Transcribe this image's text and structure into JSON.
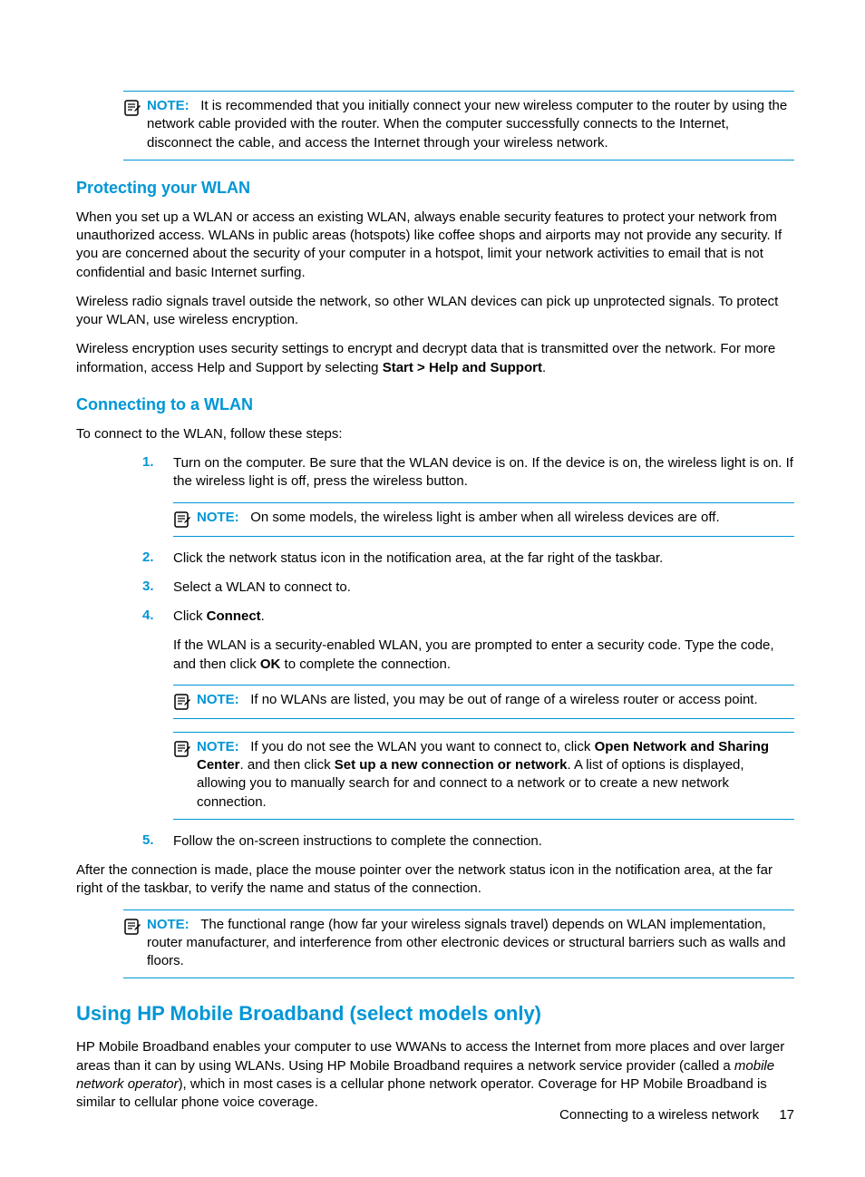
{
  "note_label": "NOTE:",
  "note1": {
    "text": "It is recommended that you initially connect your new wireless computer to the router by using the network cable provided with the router. When the computer successfully connects to the Internet, disconnect the cable, and access the Internet through your wireless network."
  },
  "sec1": {
    "heading": "Protecting your WLAN",
    "p1": "When you set up a WLAN or access an existing WLAN, always enable security features to protect your network from unauthorized access. WLANs in public areas (hotspots) like coffee shops and airports may not provide any security. If you are concerned about the security of your computer in a hotspot, limit your network activities to email that is not confidential and basic Internet surfing.",
    "p2": "Wireless radio signals travel outside the network, so other WLAN devices can pick up unprotected signals. To protect your WLAN, use wireless encryption.",
    "p3a": "Wireless encryption uses security settings to encrypt and decrypt data that is transmitted over the network. For more information, access Help and Support by selecting ",
    "p3b": "Start > Help and Support",
    "p3c": "."
  },
  "sec2": {
    "heading": "Connecting to a WLAN",
    "intro": "To connect to the WLAN, follow these steps:",
    "s1_num": "1.",
    "s1": "Turn on the computer. Be sure that the WLAN device is on. If the device is on, the wireless light is on. If the wireless light is off, press the wireless button.",
    "note_a": "On some models, the wireless light is amber when all wireless devices are off.",
    "s2_num": "2.",
    "s2": "Click the network status icon in the notification area, at the far right of the taskbar.",
    "s3_num": "3.",
    "s3": "Select a WLAN to connect to.",
    "s4_num": "4.",
    "s4a": "Click ",
    "s4b": "Connect",
    "s4c": ".",
    "s4_extra_a": "If the WLAN is a security-enabled WLAN, you are prompted to enter a security code. Type the code, and then click ",
    "s4_extra_b": "OK",
    "s4_extra_c": " to complete the connection.",
    "note_b": "If no WLANs are listed, you may be out of range of a wireless router or access point.",
    "note_c_a": "If you do not see the WLAN you want to connect to, click ",
    "note_c_b": "Open Network and Sharing Center",
    "note_c_c": ". and then click ",
    "note_c_d": "Set up a new connection or network",
    "note_c_e": ". A list of options is displayed, allowing you to manually search for and connect to a network or to create a new network connection.",
    "s5_num": "5.",
    "s5": "Follow the on-screen instructions to complete the connection.",
    "after": "After the connection is made, place the mouse pointer over the network status icon in the notification area, at the far right of the taskbar, to verify the name and status of the connection.",
    "note_d": "The functional range (how far your wireless signals travel) depends on WLAN implementation, router manufacturer, and interference from other electronic devices or structural barriers such as walls and floors."
  },
  "sec3": {
    "heading": "Using HP Mobile Broadband (select models only)",
    "p1a": "HP Mobile Broadband enables your computer to use WWANs to access the Internet from more places and over larger areas than it can by using WLANs. Using HP Mobile Broadband requires a network service provider (called a ",
    "p1b": "mobile network operator",
    "p1c": "), which in most cases is a cellular phone network operator. Coverage for HP Mobile Broadband is similar to cellular phone voice coverage."
  },
  "footer": {
    "section": "Connecting to a wireless network",
    "page": "17"
  }
}
